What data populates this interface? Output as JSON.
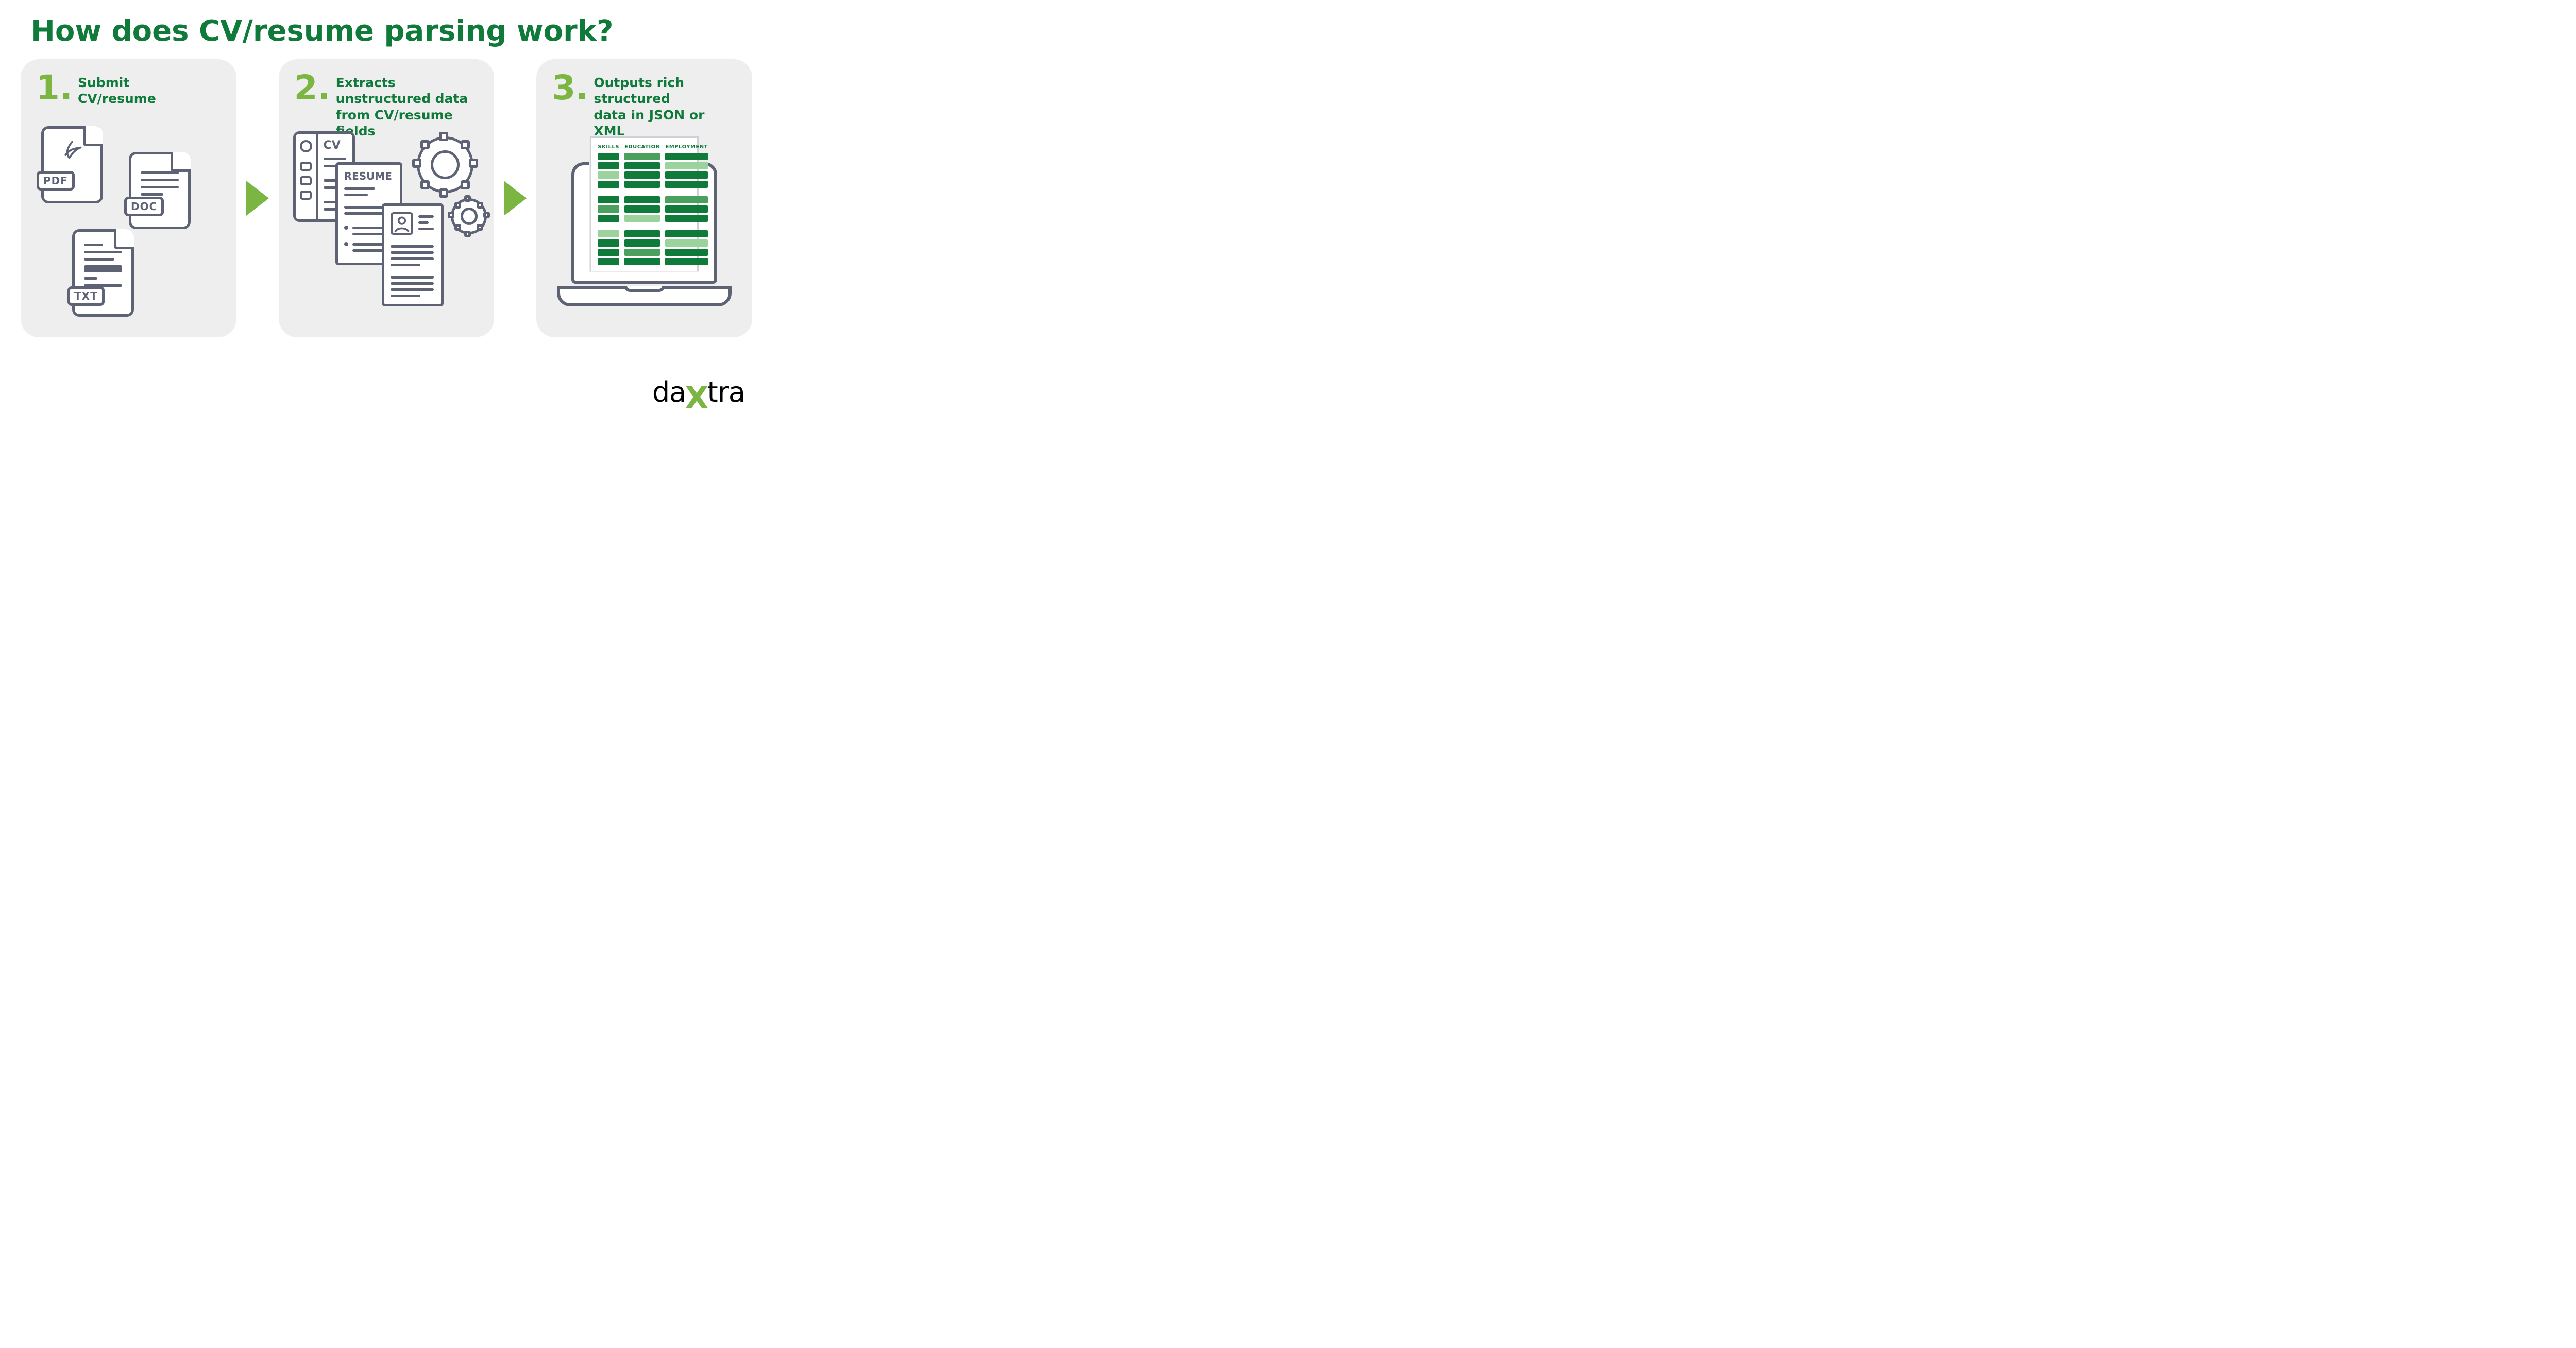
{
  "title": "How does CV/resume parsing work?",
  "steps": [
    {
      "num": "1.",
      "text": "Submit\nCV/resume"
    },
    {
      "num": "2.",
      "text": "Extracts unstructured data\nfrom CV/resume fields"
    },
    {
      "num": "3.",
      "text": "Outputs rich structured\ndata in JSON or XML"
    }
  ],
  "file_labels": {
    "pdf": "PDF",
    "doc": "DOC",
    "txt": "TXT"
  },
  "doc_labels": {
    "cv": "CV",
    "resume": "RESUME"
  },
  "sheet_headers": [
    "SKILLS",
    "EDUCATION",
    "EMPLOYMENT"
  ],
  "logo": {
    "part1": "da",
    "part2": "X",
    "part3": "tra"
  }
}
